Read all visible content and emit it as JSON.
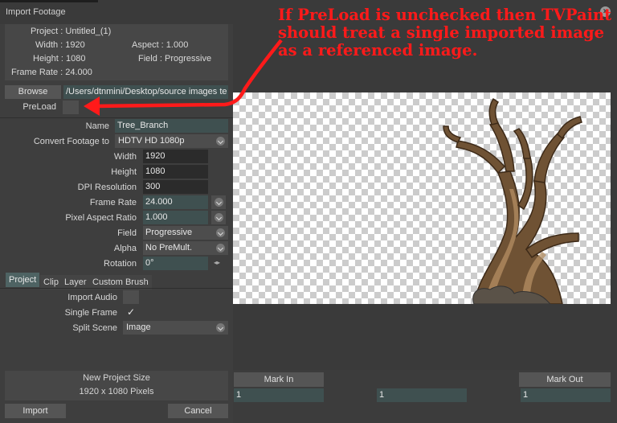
{
  "window": {
    "title": "Import Footage"
  },
  "annotation": {
    "text": "If PreLoad is unchecked then TVPaint should treat a single imported image as a referenced image."
  },
  "project_info": {
    "project": "Project : Untitled_(1)",
    "width": "Width : 1920",
    "aspect": "Aspect : 1.000",
    "height": "Height : 1080",
    "field": "Field : Progressive",
    "frame_rate": "Frame Rate : 24.000"
  },
  "browse": {
    "label": "Browse",
    "path": "/Users/dtnmini/Desktop/source images te"
  },
  "preload": {
    "label": "PreLoad"
  },
  "form": {
    "name_label": "Name",
    "name_value": "Tree_Branch",
    "convert_label": "Convert Footage to",
    "convert_value": "HDTV  HD 1080p",
    "width_label": "Width",
    "width_value": "1920",
    "height_label": "Height",
    "height_value": "1080",
    "dpi_label": "DPI Resolution",
    "dpi_value": "300",
    "framerate_label": "Frame Rate",
    "framerate_value": "24.000",
    "par_label": "Pixel Aspect Ratio",
    "par_value": "1.000",
    "field_label": "Field",
    "field_value": "Progressive",
    "alpha_label": "Alpha",
    "alpha_value": "No PreMult.",
    "rotation_label": "Rotation",
    "rotation_value": "0°"
  },
  "tabs": [
    {
      "label": "Project"
    },
    {
      "label": "Clip"
    },
    {
      "label": "Layer"
    },
    {
      "label": "Custom Brush"
    }
  ],
  "project_tab": {
    "import_audio_label": "Import Audio",
    "single_frame_label": "Single Frame",
    "single_frame_check": "✓",
    "split_scene_label": "Split Scene",
    "split_scene_value": "Image"
  },
  "new_project": {
    "title": "New Project Size",
    "size": "1920 x 1080 Pixels"
  },
  "buttons": {
    "import": "Import",
    "cancel": "Cancel",
    "mark_in": "Mark In",
    "mark_out": "Mark Out"
  },
  "timeline": {
    "mark_in_value": "1",
    "current_value": "1",
    "mark_out_value": "1"
  },
  "colors": {
    "annotation": "#ff1a1a",
    "field_teal": "#3f5050",
    "tab_active": "#4e6363"
  }
}
